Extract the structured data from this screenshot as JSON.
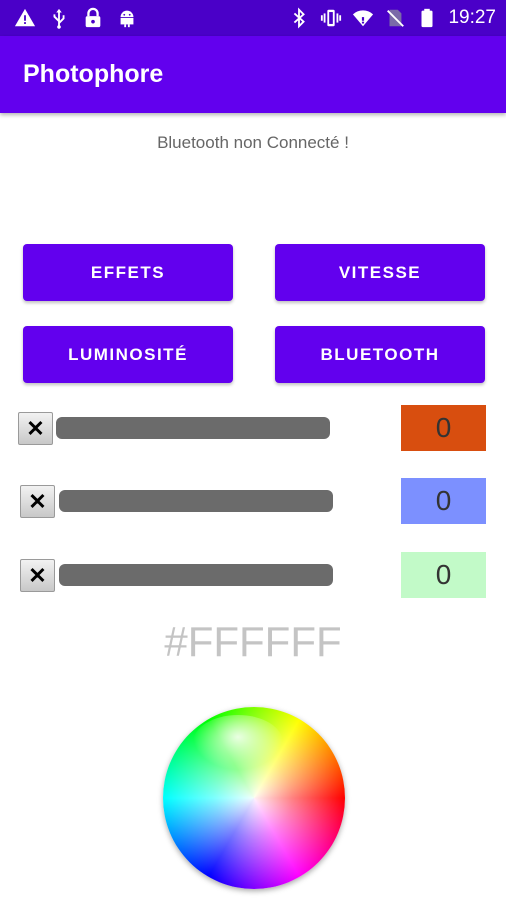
{
  "status_bar": {
    "time": "19:27",
    "left_icons": [
      "warning-icon",
      "usb-icon",
      "lock-icon",
      "android-icon"
    ],
    "right_icons": [
      "bluetooth-icon",
      "vibrate-icon",
      "wifi-icon",
      "no-sim-icon",
      "battery-icon"
    ]
  },
  "app_bar": {
    "title": "Photophore"
  },
  "connection_status": "Bluetooth non Connecté !",
  "buttons": {
    "effects": "EFFETS",
    "speed": "VITESSE",
    "brightness": "LUMINOSITÉ",
    "bluetooth": "BLUETOOTH"
  },
  "channels": [
    {
      "clear_label": "✕",
      "value": "0",
      "color": "#d84e0f"
    },
    {
      "clear_label": "✕",
      "value": "0",
      "color": "#7c90ff"
    },
    {
      "clear_label": "✕",
      "value": "0",
      "color": "#c2fac8"
    }
  ],
  "hex_value": "#FFFFFF",
  "colors": {
    "primary": "#6200ee",
    "primary_dark": "#4a00c8"
  }
}
